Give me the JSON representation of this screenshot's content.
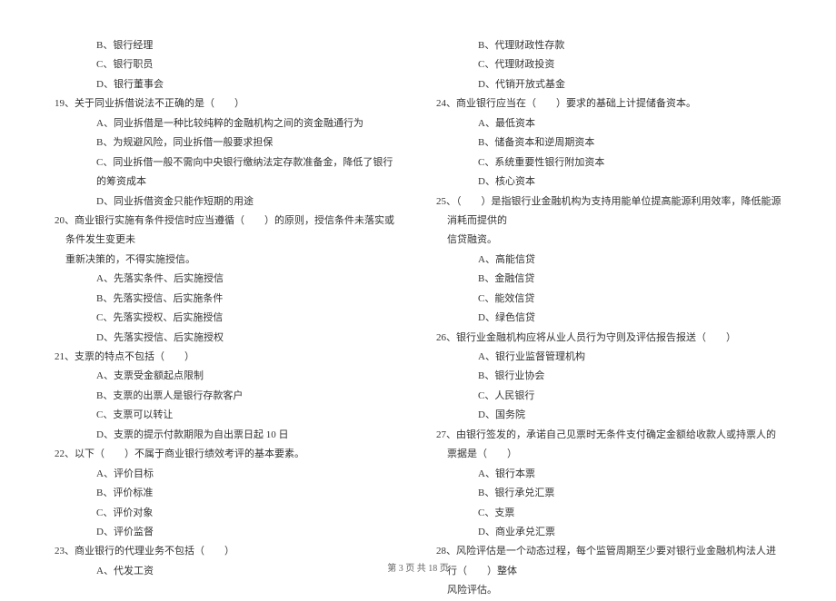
{
  "left": {
    "opt_B": "B、银行经理",
    "opt_C": "C、银行职员",
    "opt_D": "D、银行董事会",
    "q19": "19、关于同业拆借说法不正确的是（　　）",
    "q19_A": "A、同业拆借是一种比较纯粹的金融机构之间的资金融通行为",
    "q19_B": "B、为规避风险，同业拆借一般要求担保",
    "q19_C": "C、同业拆借一般不需向中央银行缴纳法定存款准备金，降低了银行的筹资成本",
    "q19_D": "D、同业拆借资金只能作短期的用途",
    "q20_l1": "20、商业银行实施有条件授信时应当遵循（　　）的原则，授信条件未落实或条件发生变更未",
    "q20_l2": "重新决策的，不得实施授信。",
    "q20_A": "A、先落实条件、后实施授信",
    "q20_B": "B、先落实授信、后实施条件",
    "q20_C": "C、先落实授权、后实施授信",
    "q20_D": "D、先落实授信、后实施授权",
    "q21": "21、支票的特点不包括（　　）",
    "q21_A": "A、支票受金额起点限制",
    "q21_B": "B、支票的出票人是银行存款客户",
    "q21_C": "C、支票可以转让",
    "q21_D": "D、支票的提示付款期限为自出票日起 10 日",
    "q22": "22、以下（　　）不属于商业银行绩效考评的基本要素。",
    "q22_A": "A、评价目标",
    "q22_B": "B、评价标准",
    "q22_C": "C、评价对象",
    "q22_D": "D、评价监督",
    "q23": "23、商业银行的代理业务不包括（　　）",
    "q23_A": "A、代发工资"
  },
  "right": {
    "opt_B": "B、代理财政性存款",
    "opt_C": "C、代理财政投资",
    "opt_D": "D、代销开放式基金",
    "q24": "24、商业银行应当在（　　）要求的基础上计提储备资本。",
    "q24_A": "A、最低资本",
    "q24_B": "B、储备资本和逆周期资本",
    "q24_C": "C、系统重要性银行附加资本",
    "q24_D": "D、核心资本",
    "q25_l1": "25、（　　）是指银行业金融机构为支持用能单位提高能源利用效率，降低能源消耗而提供的",
    "q25_l2": "信贷融资。",
    "q25_A": "A、高能信贷",
    "q25_B": "B、金融信贷",
    "q25_C": "C、能效信贷",
    "q25_D": "D、绿色信贷",
    "q26": "26、银行业金融机构应将从业人员行为守则及评估报告报送（　　）",
    "q26_A": "A、银行业监督管理机构",
    "q26_B": "B、银行业协会",
    "q26_C": "C、人民银行",
    "q26_D": "D、国务院",
    "q27": "27、由银行签发的，承诺自己见票时无条件支付确定金额给收款人或持票人的票据是（　　）",
    "q27_A": "A、银行本票",
    "q27_B": "B、银行承兑汇票",
    "q27_C": "C、支票",
    "q27_D": "D、商业承兑汇票",
    "q28_l1": "28、风险评估是一个动态过程，每个监管周期至少要对银行业金融机构法人进行（　　）整体",
    "q28_l2": "风险评估。"
  },
  "footer": "第 3 页 共 18 页"
}
